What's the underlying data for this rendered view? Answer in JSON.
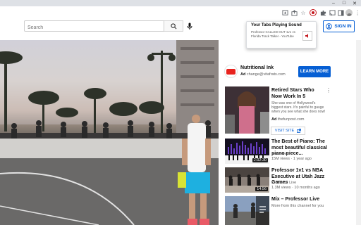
{
  "colors": {
    "brand_blue": "#065fd4",
    "youtube_red": "#ff0000",
    "popup_accent": "#c4171d"
  },
  "browser": {
    "window_controls": [
      "minimize",
      "maximize",
      "close"
    ],
    "toolbar_icons": [
      "share-icon",
      "star-icon",
      "extension-tabs-playing-icon",
      "extensions-puzzle-icon",
      "cast-icon",
      "sidepanel-icon",
      "profile-icon",
      "menu-dots-icon"
    ]
  },
  "search": {
    "placeholder": "Search"
  },
  "header": {
    "signin_label": "SIGN IN"
  },
  "popup": {
    "title": "Your Tabs Playing Sound",
    "item_text": "Professor CALLED OUT 1v1 vs Florida Track Talker - YouTube"
  },
  "ad": {
    "title": "Nutritional Ink",
    "badge": "Ad",
    "domain": "change@vitafrats.com",
    "cta": "LEARN MORE"
  },
  "promoted": {
    "title": "Retired Stars Who Now Work In 5",
    "description": "She was one of Hollywood's biggest stars. It's painful to gauge when you see what she does now!",
    "badge": "Ad",
    "source": "thefunpost.com",
    "cta": "VISIT SITE"
  },
  "videos": [
    {
      "title": "The Best of Piano: The most beautiful classical piano piece...",
      "channel": "Rousseau",
      "stats": "15M views · 1 year ago",
      "duration": "2:32:30"
    },
    {
      "title": "Professor 1v1 vs NBA Executive at Utah Jazz Games",
      "channel": "Professor Live",
      "stats": "1.3M views · 10 months ago",
      "duration": "14:56"
    },
    {
      "title": "Mix – Professor Live",
      "channel": "More from this channel for you",
      "stats": "",
      "duration": ""
    }
  ]
}
